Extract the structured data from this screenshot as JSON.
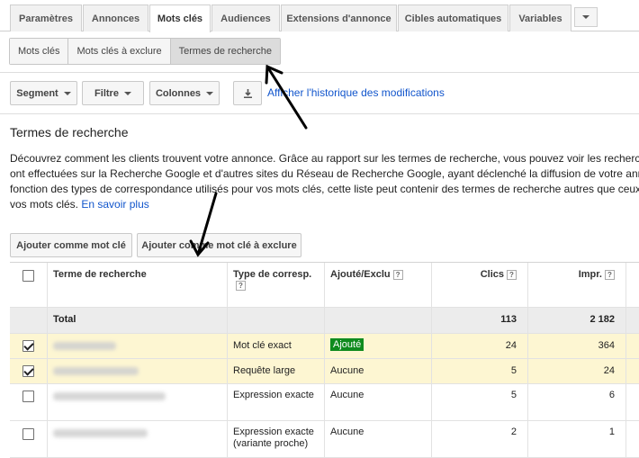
{
  "tabs": [
    {
      "label": "Paramètres"
    },
    {
      "label": "Annonces"
    },
    {
      "label": "Mots clés",
      "active": true
    },
    {
      "label": "Audiences"
    },
    {
      "label": "Extensions d'annonce"
    },
    {
      "label": "Cibles automatiques"
    },
    {
      "label": "Variables"
    }
  ],
  "subtabs": [
    {
      "label": "Mots clés"
    },
    {
      "label": "Mots clés à exclure"
    },
    {
      "label": "Termes de recherche",
      "active": true
    }
  ],
  "toolbar": {
    "segment": "Segment",
    "filter": "Filtre",
    "columns": "Colonnes",
    "history_link": "Afficher l'historique des modifications"
  },
  "page": {
    "title": "Termes de recherche",
    "description_lines": [
      "Découvrez comment les clients trouvent votre annonce. Grâce au rapport sur les termes de recherche, vous pouvez voir les recherches",
      "ont effectuées sur la Recherche Google et d'autres sites du Réseau de Recherche Google, ayant déclenché la diffusion de votre annonce",
      "fonction des types de correspondance utilisés pour vos mots clés, cette liste peut contenir des termes de recherche autres que ceux de",
      "vos mots clés."
    ],
    "learn_more": "En savoir plus"
  },
  "actions": {
    "add_keyword": "Ajouter comme mot clé",
    "add_negative": "Ajouter comme mot clé à exclure"
  },
  "table": {
    "headers": {
      "term": "Terme de recherche",
      "match_type": "Type de corresp.",
      "added": "Ajouté/Exclu",
      "clicks": "Clics",
      "impr": "Impr."
    },
    "help_symbol": "?",
    "total": {
      "label": "Total",
      "clicks": "113",
      "impr": "2 182"
    },
    "rows": [
      {
        "checked": true,
        "match_type": "Mot clé exact",
        "added": "Ajouté",
        "clicks": "24",
        "impr": "364"
      },
      {
        "checked": true,
        "match_type": "Requête large",
        "added": "Aucune",
        "clicks": "5",
        "impr": "24"
      },
      {
        "checked": false,
        "match_type": "Expression exacte",
        "added": "Aucune",
        "clicks": "5",
        "impr": "6"
      },
      {
        "checked": false,
        "match_type": "Expression exacte (variante proche)",
        "added": "Aucune",
        "clicks": "2",
        "impr": "1"
      }
    ]
  },
  "colors": {
    "link": "#1155cc",
    "selected_row": "#fdf6d2",
    "added_badge": "#0f8b1e",
    "total_row": "#ececec"
  },
  "icons": [
    "caret-down-icon",
    "download-icon",
    "help-icon",
    "checkbox-icon",
    "arrow-annotation"
  ]
}
